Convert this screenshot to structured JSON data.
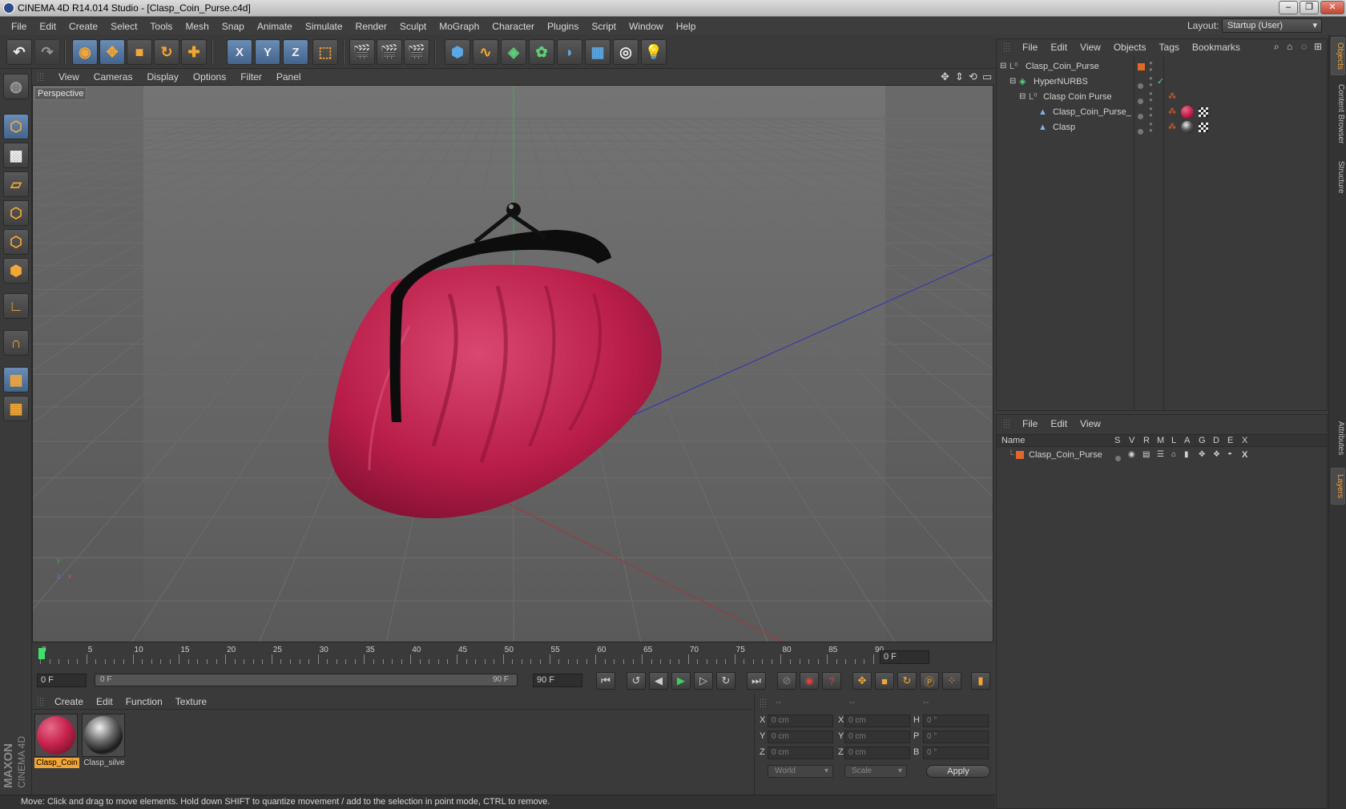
{
  "window": {
    "title": "CINEMA 4D R14.014 Studio - [Clasp_Coin_Purse.c4d]"
  },
  "menubar": [
    "File",
    "Edit",
    "Create",
    "Select",
    "Tools",
    "Mesh",
    "Snap",
    "Animate",
    "Simulate",
    "Render",
    "Sculpt",
    "MoGraph",
    "Character",
    "Plugins",
    "Script",
    "Window",
    "Help"
  ],
  "layout": {
    "label": "Layout:",
    "value": "Startup (User)"
  },
  "toolbar": {
    "axis_x": "X",
    "axis_y": "Y",
    "axis_z": "Z"
  },
  "viewport": {
    "menu": [
      "View",
      "Cameras",
      "Display",
      "Options",
      "Filter",
      "Panel"
    ],
    "label": "Perspective",
    "axis_y": "y",
    "axis_z": "z",
    "axis_x": "x"
  },
  "timeline": {
    "ticks": [
      "0",
      "5",
      "10",
      "15",
      "20",
      "25",
      "30",
      "35",
      "40",
      "45",
      "50",
      "55",
      "60",
      "65",
      "70",
      "75",
      "80",
      "85",
      "90"
    ],
    "current_frame": "0 F"
  },
  "transport": {
    "start_field": "0 F",
    "range_start": "0 F",
    "range_end": "90 F",
    "end_field": "90 F"
  },
  "materials": {
    "menu": [
      "Create",
      "Edit",
      "Function",
      "Texture"
    ],
    "items": [
      {
        "name": "Clasp_Coin",
        "color": "#c8244e"
      },
      {
        "name": "Clasp_silve",
        "color": "#8a8a8a"
      }
    ]
  },
  "coordinates": {
    "header": [
      "--",
      "--",
      "--"
    ],
    "rows": [
      {
        "a": "X",
        "a_val": "0 cm",
        "b": "X",
        "b_val": "0 cm",
        "c": "H",
        "c_val": "0 °"
      },
      {
        "a": "Y",
        "a_val": "0 cm",
        "b": "Y",
        "b_val": "0 cm",
        "c": "P",
        "c_val": "0 °"
      },
      {
        "a": "Z",
        "a_val": "0 cm",
        "b": "Z",
        "b_val": "0 cm",
        "c": "B",
        "c_val": "0 °"
      }
    ],
    "mode": "World",
    "transform": "Scale",
    "apply": "Apply"
  },
  "status": "Move: Click and drag to move elements. Hold down SHIFT to quantize movement / add to the selection in point mode, CTRL to remove.",
  "brand": {
    "maxon": "MAXON",
    "cinema": "CINEMA 4D"
  },
  "objects": {
    "menu": [
      "File",
      "Edit",
      "View",
      "Objects",
      "Tags",
      "Bookmarks"
    ],
    "items": [
      {
        "name": "Clasp_Coin_Purse",
        "indent": 0
      },
      {
        "name": "HyperNURBS",
        "indent": 1
      },
      {
        "name": "Clasp Coin Purse",
        "indent": 2
      },
      {
        "name": "Clasp_Coin_Purse_",
        "indent": 3
      },
      {
        "name": "Clasp",
        "indent": 3
      }
    ]
  },
  "layers": {
    "menu": [
      "File",
      "Edit",
      "View"
    ],
    "columns": [
      "Name",
      "S",
      "V",
      "R",
      "M",
      "L",
      "A",
      "G",
      "D",
      "E",
      "X"
    ],
    "items": [
      {
        "name": "Clasp_Coin_Purse",
        "color": "#e2672a"
      }
    ]
  },
  "right_tabs": [
    "Objects",
    "Content Browser",
    "Structure",
    "Attributes",
    "Layers"
  ],
  "colors": {
    "accent": "#f3a635",
    "selection": "#5d82b0",
    "purse": "#c8244e"
  }
}
